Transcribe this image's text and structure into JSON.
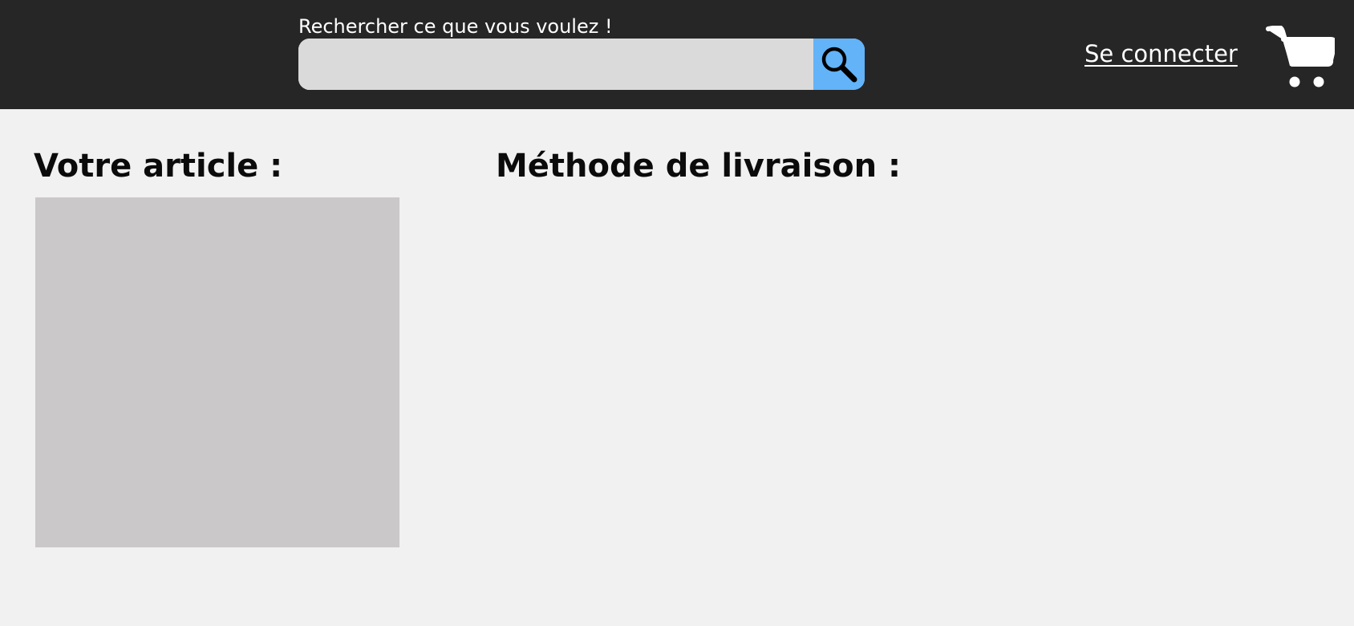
{
  "header": {
    "search": {
      "caption": "Rechercher ce que vous voulez !",
      "value": "",
      "placeholder": "",
      "button_icon": "search-icon",
      "button_color": "#62b3f8"
    },
    "login_label": "Se connecter",
    "cart_icon": "cart-icon",
    "background_color": "#262626"
  },
  "main": {
    "article_title": "Votre article :",
    "delivery_title": "Méthode de livraison :",
    "image_placeholder_color": "#cac8c9",
    "background_color": "#f1f1f1"
  }
}
